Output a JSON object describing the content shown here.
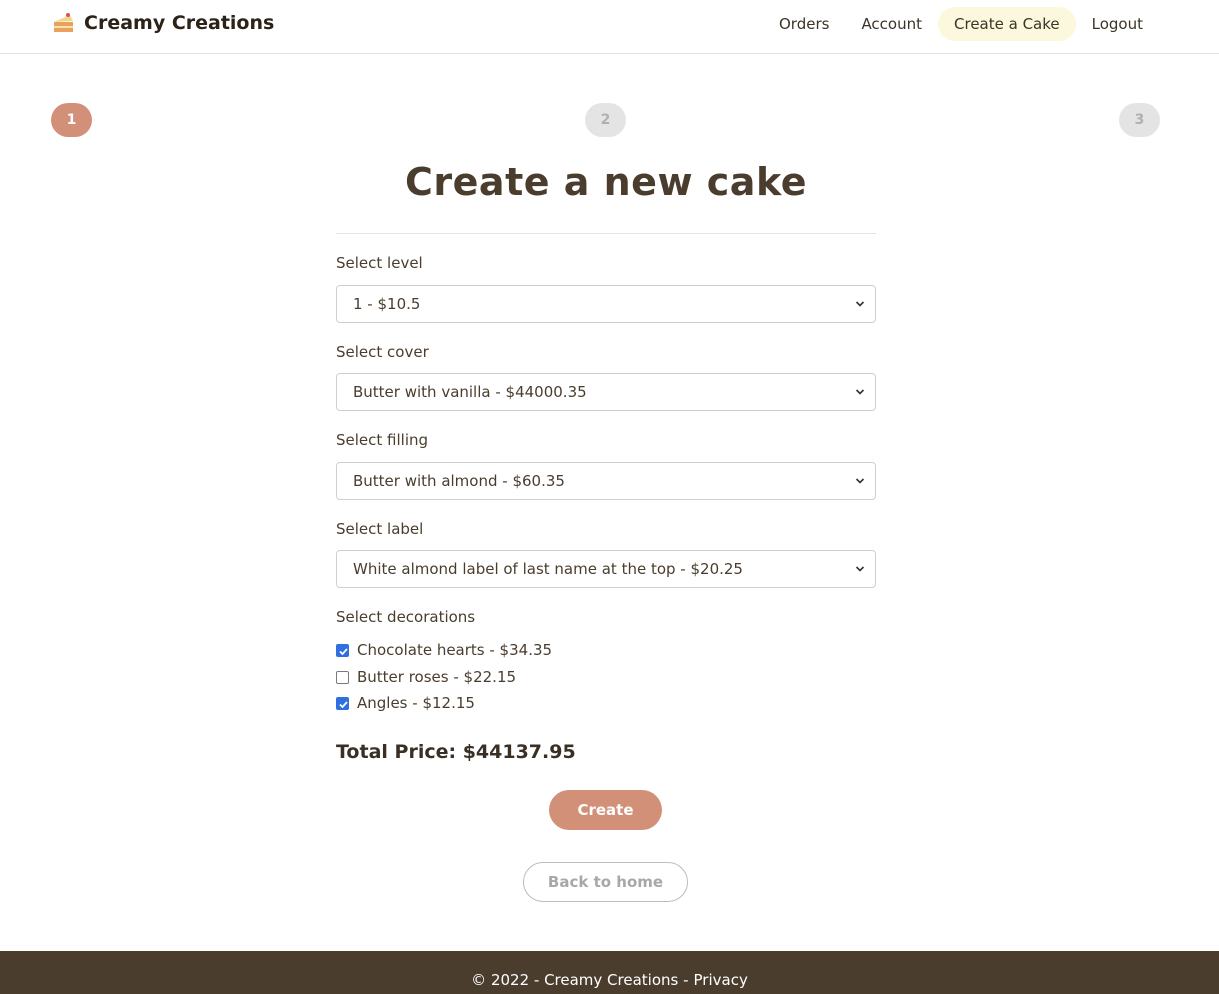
{
  "brand": {
    "name": "Creamy Creations",
    "icon": "cake-slice-icon"
  },
  "nav": {
    "links": [
      {
        "label": "Orders"
      },
      {
        "label": "Account"
      },
      {
        "label": "Create a Cake",
        "active": true
      },
      {
        "label": "Logout"
      }
    ]
  },
  "steps": [
    {
      "label": "1",
      "active": true
    },
    {
      "label": "2",
      "active": false
    },
    {
      "label": "3",
      "active": false
    }
  ],
  "form": {
    "title": "Create a new cake",
    "level": {
      "label": "Select level",
      "value": "1 - $10.5"
    },
    "cover": {
      "label": "Select cover",
      "value": "Butter with vanilla - $44000.35"
    },
    "filling": {
      "label": "Select filling",
      "value": "Butter with almond - $60.35"
    },
    "cake_label": {
      "label": "Select label",
      "value": "White almond label of last name at the top - $20.25"
    },
    "decorations": {
      "label": "Select decorations",
      "items": [
        {
          "label": "Chocolate hearts - $34.35",
          "checked": true
        },
        {
          "label": "Butter roses - $22.15",
          "checked": false
        },
        {
          "label": "Angles - $12.15",
          "checked": true
        }
      ]
    },
    "total": "Total Price: $44137.95",
    "create_label": "Create",
    "back_label": "Back to home"
  },
  "footer": {
    "copyright": "© 2022 - Creamy Creations -",
    "privacy": "Privacy"
  },
  "colors": {
    "accent": "#d29079",
    "nav_active_bg": "#fbf8dd",
    "footer_bg": "#4a3d2e",
    "checkbox_checked": "#2f6fe0"
  }
}
